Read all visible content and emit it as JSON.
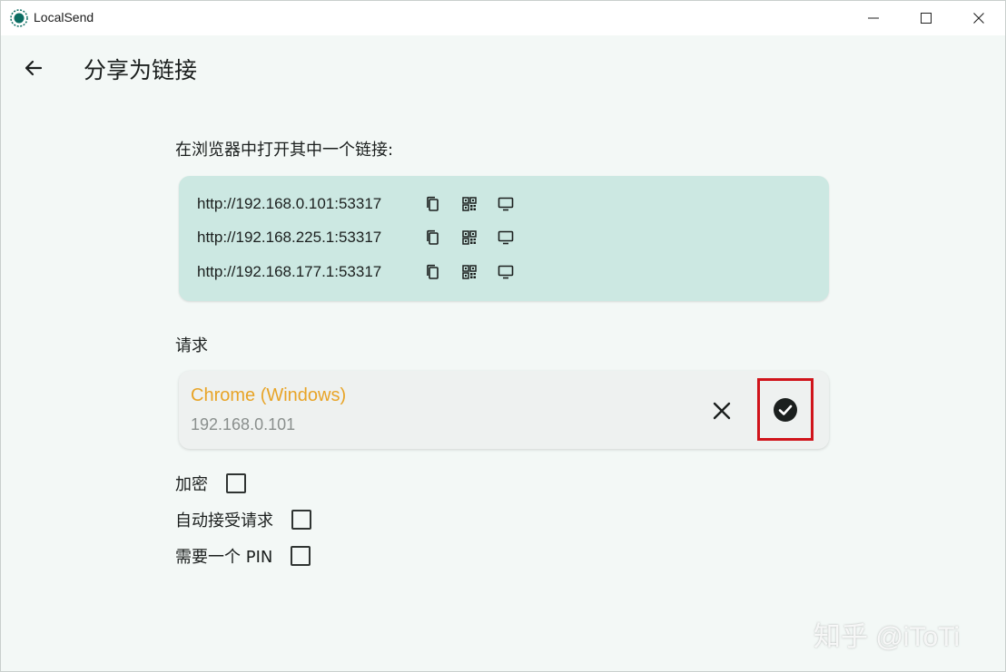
{
  "window": {
    "title": "LocalSend",
    "accent_color": "#0b6c62"
  },
  "appbar": {
    "title": "分享为链接"
  },
  "links_section": {
    "label": "在浏览器中打开其中一个链接:",
    "card_color": "#cce8e2",
    "links": [
      {
        "url": "http://192.168.0.101:53317"
      },
      {
        "url": "http://192.168.225.1:53317"
      },
      {
        "url": "http://192.168.177.1:53317"
      }
    ],
    "icons": [
      "copy-icon",
      "qr-code-icon",
      "monitor-icon"
    ]
  },
  "requests_section": {
    "label": "请求",
    "requests": [
      {
        "name": "Chrome (Windows)",
        "ip": "192.168.0.101"
      }
    ],
    "name_color": "#e8a427",
    "highlight_color": "#d0141b"
  },
  "options": [
    {
      "label": "加密",
      "checked": false
    },
    {
      "label": "自动接受请求",
      "checked": false
    },
    {
      "label": "需要一个 PIN",
      "checked": false
    }
  ],
  "watermark": "知乎 @iToTi"
}
